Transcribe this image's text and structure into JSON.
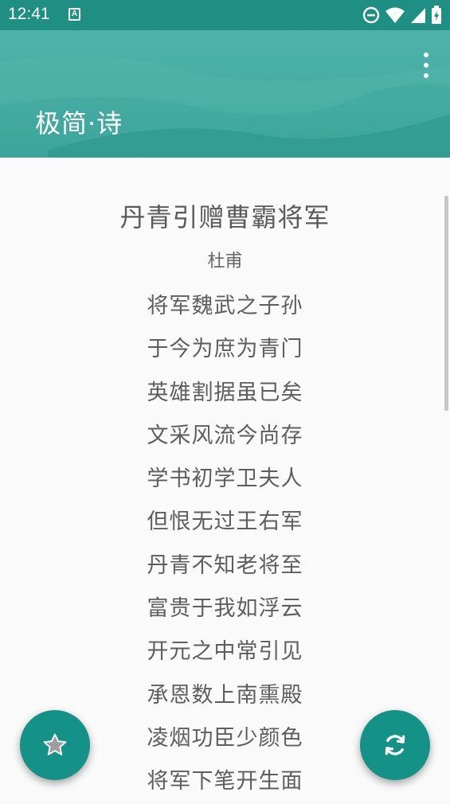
{
  "status_bar": {
    "time": "12:41",
    "notification_glyph": "A",
    "icons": [
      "dnd-icon",
      "wifi-icon",
      "signal-icon",
      "battery-charging-icon"
    ]
  },
  "app_bar": {
    "title": "极简·诗",
    "menu_icon": "more-vert-icon"
  },
  "poem": {
    "title": "丹青引赠曹霸将军",
    "author": "杜甫",
    "lines": [
      "将军魏武之子孙",
      "于今为庶为青门",
      "英雄割据虽已矣",
      "文采风流今尚存",
      "学书初学卫夫人",
      "但恨无过王右军",
      "丹青不知老将至",
      "富贵于我如浮云",
      "开元之中常引见",
      "承恩数上南熏殿",
      "凌烟功臣少颜色",
      "将军下笔开生面"
    ]
  },
  "fabs": {
    "favorite_icon": "star-icon",
    "refresh_icon": "refresh-icon"
  },
  "colors": {
    "status_bar": "#1f8f84",
    "header": "#4fb3ab",
    "fab": "#149287",
    "background": "#fafafa",
    "text": "#5e5e5e"
  }
}
